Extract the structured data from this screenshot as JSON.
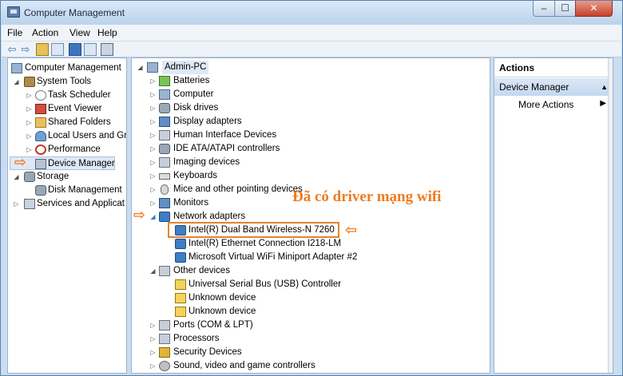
{
  "window": {
    "title": "Computer Management",
    "controls": {
      "min": "–",
      "max": "☐",
      "close": "✕"
    }
  },
  "menu": [
    "File",
    "Action",
    "View",
    "Help"
  ],
  "toolbar": {
    "back": "⇦",
    "forward": "⇨",
    "icons": [
      "up-folder-icon",
      "show-hide-tree-icon",
      "help-icon",
      "properties-icon",
      "refresh-icon"
    ]
  },
  "left_tree": {
    "root": "Computer Management",
    "system_tools": "System Tools",
    "task_scheduler": "Task Scheduler",
    "event_viewer": "Event Viewer",
    "shared_folders": "Shared Folders",
    "local_users": "Local Users and Gr",
    "performance": "Performance",
    "device_manager": "Device Manager",
    "storage": "Storage",
    "disk_management": "Disk Management",
    "services": "Services and Applicat"
  },
  "device_tree": {
    "root": "Admin-PC",
    "categories": [
      "Batteries",
      "Computer",
      "Disk drives",
      "Display adapters",
      "Human Interface Devices",
      "IDE ATA/ATAPI controllers",
      "Imaging devices",
      "Keyboards",
      "Mice and other pointing devices",
      "Monitors"
    ],
    "network_adapters": "Network adapters",
    "network_children": [
      "Intel(R) Dual Band Wireless-N 7260",
      "Intel(R) Ethernet Connection I218-LM",
      "Microsoft Virtual WiFi Miniport Adapter #2"
    ],
    "other_devices": "Other devices",
    "other_children": [
      "Universal Serial Bus (USB) Controller",
      "Unknown device",
      "Unknown device"
    ],
    "rest": [
      "Ports (COM & LPT)",
      "Processors",
      "Security Devices",
      "Sound, video and game controllers"
    ]
  },
  "annotation": "Đã có driver mạng wifi",
  "actions": {
    "title": "Actions",
    "section": "Device Manager",
    "more": "More Actions"
  },
  "colors": {
    "accent_orange": "#f07b1f"
  }
}
